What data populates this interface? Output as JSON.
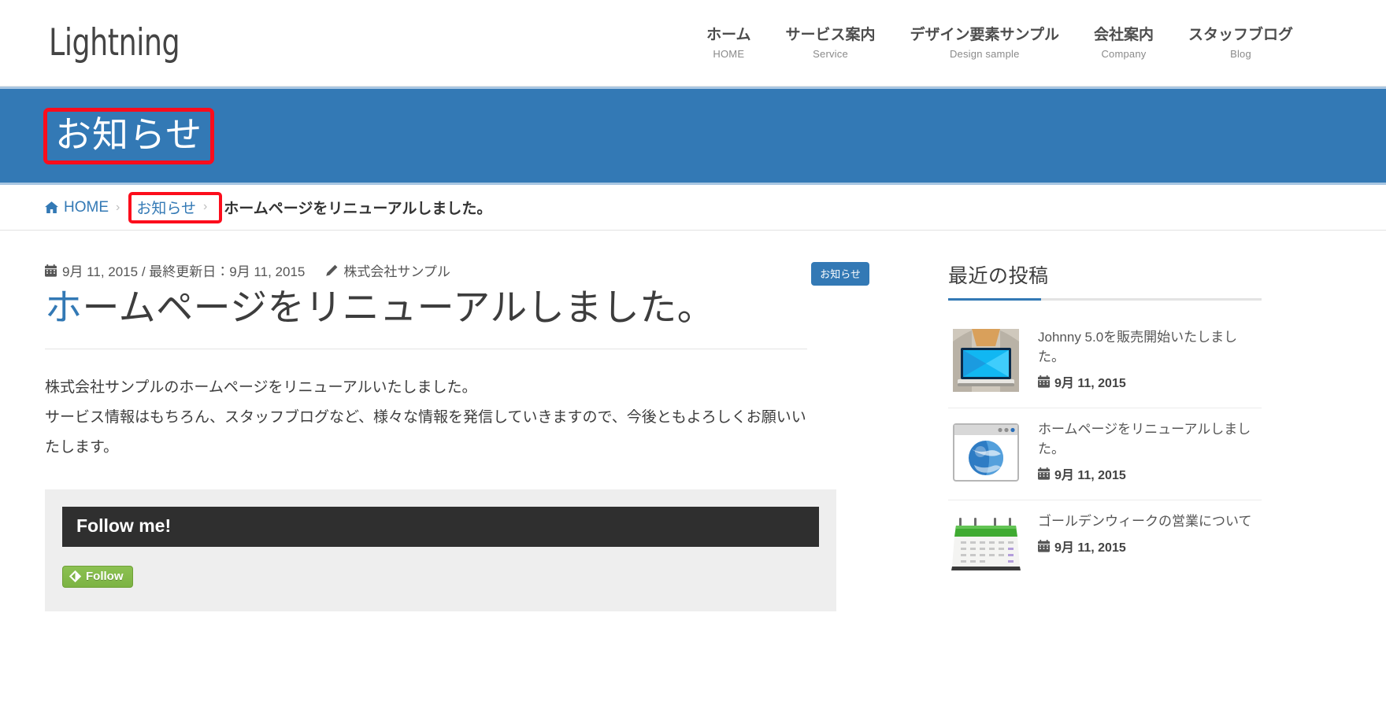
{
  "header": {
    "logo": "Lightning",
    "nav": [
      {
        "main": "ホーム",
        "sub": "HOME"
      },
      {
        "main": "サービス案内",
        "sub": "Service"
      },
      {
        "main": "デザイン要素サンプル",
        "sub": "Design sample"
      },
      {
        "main": "会社案内",
        "sub": "Company"
      },
      {
        "main": "スタッフブログ",
        "sub": "Blog"
      }
    ]
  },
  "page": {
    "title": "お知らせ",
    "title_band_color": "#3379b5",
    "annotation_color": "#fc0d1c"
  },
  "breadcrumb": {
    "home_label": "HOME",
    "home_icon": "home-icon",
    "separator": "›",
    "category": "お知らせ",
    "current": "ホームページをリニューアルしました。"
  },
  "article": {
    "date_icon": "calendar-icon",
    "date": "9月 11, 2015 / 最終更新日：9月 11, 2015",
    "author_icon": "pencil-icon",
    "author": "株式会社サンプル",
    "category_badge": "お知らせ",
    "title_accent": "ホ",
    "title_rest": "ームページをリニューアルしました。",
    "body_line1": "株式会社サンプルのホームページをリニューアルいたしました。",
    "body_line2": "サービス情報はもちろん、スタッフブログなど、様々な情報を発信していきますので、今後ともよろしくお願いいたします。"
  },
  "follow_widget": {
    "heading": "Follow me!",
    "button_label": "Follow",
    "button_icon": "feedly-icon",
    "button_color": "#8cc152"
  },
  "sidebar": {
    "recent_posts_title": "最近の投稿",
    "posts": [
      {
        "title": "Johnny 5.0を販売開始いたしました。",
        "date": "9月 11, 2015",
        "date_icon": "calendar-icon",
        "thumb": "laptop-person-thumbnail"
      },
      {
        "title": "ホームページをリニューアルしました。",
        "date": "9月 11, 2015",
        "date_icon": "calendar-icon",
        "thumb": "browser-globe-thumbnail"
      },
      {
        "title": "ゴールデンウィークの営業について",
        "date": "9月 11, 2015",
        "date_icon": "calendar-icon",
        "thumb": "wall-calendar-thumbnail"
      }
    ]
  }
}
